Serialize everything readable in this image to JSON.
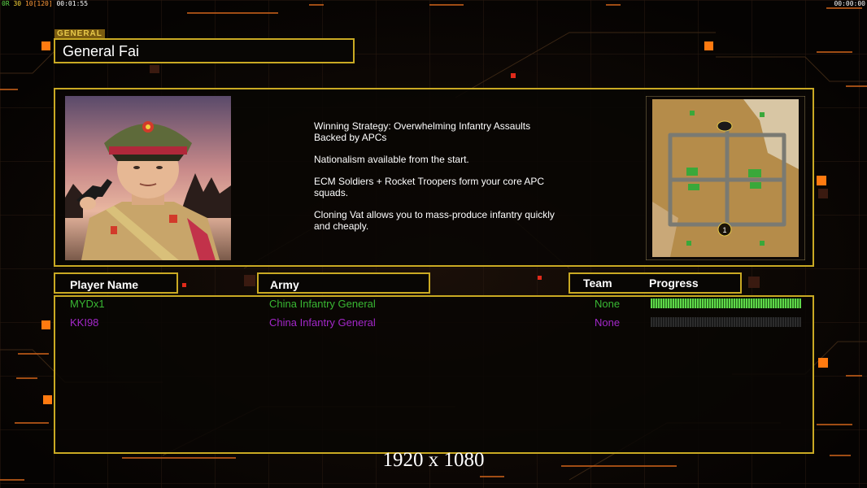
{
  "hud": {
    "top_left_stats": [
      "0R",
      "30",
      "10[120]",
      "00:01:55"
    ],
    "top_right_timer": "00:00:00"
  },
  "general_tag": "GENERAL",
  "general_name": "General Fai",
  "strategy": [
    "Winning Strategy: Overwhelming Infantry Assaults\n Backed by APCs",
    "Nationalism available from the start.",
    "ECM Soldiers + Rocket Troopers form your core APC\n squads.",
    "Cloning Vat allows you to mass-produce infantry quickly\n and cheaply."
  ],
  "columns": {
    "player_name": "Player Name",
    "army": "Army",
    "team": "Team",
    "progress": "Progress"
  },
  "players": [
    {
      "name": "MYDx1",
      "army": "China Infantry General",
      "team": "None",
      "progress": 1.0,
      "color": "#39b833"
    },
    {
      "name": "KKI98",
      "army": "China Infantry General",
      "team": "None",
      "progress": 0.0,
      "color": "#a327c9"
    }
  ],
  "map": {
    "start_positions": [
      "1"
    ]
  },
  "resolution_overlay": "1920 x 1080",
  "colors": {
    "frame": "#c9a923",
    "accent_orange": "#ff7a10",
    "progress_fill": "#5fd84a",
    "progress_empty": "#2c2c2c"
  }
}
